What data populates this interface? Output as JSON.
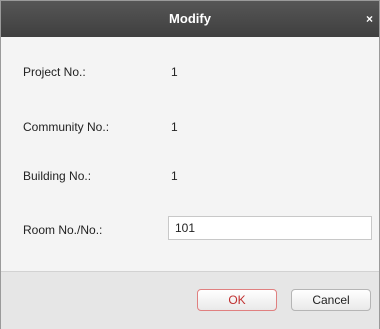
{
  "dialog": {
    "title": "Modify",
    "close_symbol": "×"
  },
  "fields": [
    {
      "label": "Project No.:",
      "value": "1"
    },
    {
      "label": "Community No.:",
      "value": "1"
    },
    {
      "label": "Building No.:",
      "value": "1"
    }
  ],
  "room": {
    "label": "Room No./No.:",
    "value": "101"
  },
  "buttons": {
    "ok": "OK",
    "cancel": "Cancel"
  },
  "colors": {
    "titlebar": "#4a4a4a",
    "ok_accent": "#c03030"
  }
}
